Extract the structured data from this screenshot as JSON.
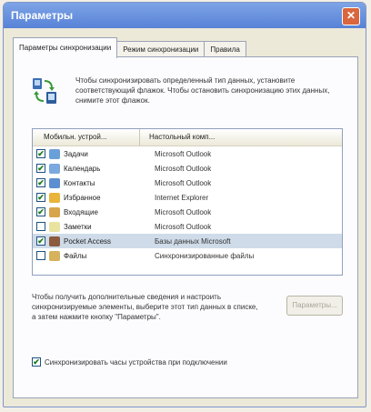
{
  "window": {
    "title": "Параметры"
  },
  "tabs": [
    {
      "label": "Параметры синхронизации",
      "active": true
    },
    {
      "label": "Режим синхронизации",
      "active": false
    },
    {
      "label": "Правила",
      "active": false
    }
  ],
  "intro": {
    "text": "Чтобы синхронизировать определенный тип данных, установите соответствующий флажок. Чтобы остановить синхронизацию этих данных, снимите этот флажок."
  },
  "list": {
    "headers": {
      "type": "Мобильн. устрой...",
      "app": "Настольный комп..."
    },
    "rows": [
      {
        "name": "Задачи",
        "app": "Microsoft Outlook",
        "checked": true,
        "selected": false,
        "icon": "tasks-icon",
        "color": "#6aa0d8"
      },
      {
        "name": "Календарь",
        "app": "Microsoft Outlook",
        "checked": true,
        "selected": false,
        "icon": "calendar-icon",
        "color": "#7ba8dd"
      },
      {
        "name": "Контакты",
        "app": "Microsoft Outlook",
        "checked": true,
        "selected": false,
        "icon": "contacts-icon",
        "color": "#5c8fcf"
      },
      {
        "name": "Избранное",
        "app": "Internet Explorer",
        "checked": true,
        "selected": false,
        "icon": "favorites-icon",
        "color": "#e8b43a"
      },
      {
        "name": "Входящие",
        "app": "Microsoft Outlook",
        "checked": true,
        "selected": false,
        "icon": "inbox-icon",
        "color": "#d8a64a"
      },
      {
        "name": "Заметки",
        "app": "Microsoft Outlook",
        "checked": false,
        "selected": false,
        "icon": "notes-icon",
        "color": "#e9e3a0"
      },
      {
        "name": "Pocket Access",
        "app": "Базы данных Microsoft",
        "checked": true,
        "selected": true,
        "icon": "pocket-access-icon",
        "color": "#8c5a3c"
      },
      {
        "name": "Файлы",
        "app": "Синхронизированные файлы",
        "checked": false,
        "selected": false,
        "icon": "files-icon",
        "color": "#d6b25c"
      }
    ]
  },
  "bottom_text": "Чтобы получить дополнительные сведения и настроить синхронизируемые элементы, выберите этот тип данных в списке, а затем нажмите кнопку \"Параметры\".",
  "params_button": "Параметры...",
  "autosync": {
    "label": "Синхронизировать часы устройства при подключении",
    "checked": true
  }
}
